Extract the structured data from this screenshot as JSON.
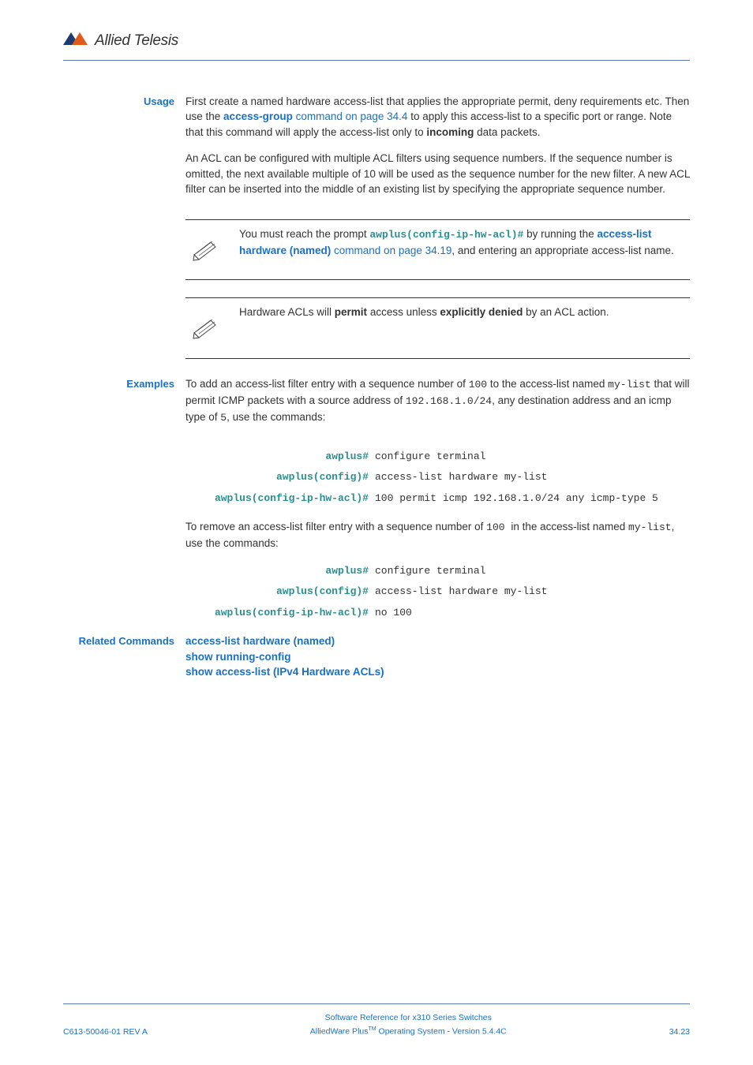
{
  "logo": {
    "brand": "Allied Telesis"
  },
  "usage": {
    "label": "Usage",
    "para1_a": "First create a named hardware access-list that applies the appropriate permit, deny requirements etc. Then use the ",
    "para1_link": "access-group",
    "para1_b": " command on page 34.4",
    "para1_c": " to apply this access-list to a specific port or range. Note that this command will apply the access-list only to ",
    "para1_bold": "incoming",
    "para1_d": " data packets.",
    "para2": "An ACL can be configured with multiple ACL filters using sequence numbers. If the sequence number is omitted, the next available multiple of 10 will be used as the sequence number for the new filter. A new ACL filter can be inserted into the middle of an existing list by specifying the appropriate sequence number."
  },
  "note1": {
    "pre": "You must reach the prompt ",
    "mono": "awplus(config-ip-hw-acl)#",
    "mid": " by running the ",
    "link": "access-list hardware (named)",
    "post_link": " command on page 34.19",
    "tail": ", and entering an appropriate access-list name."
  },
  "note2": {
    "a": "Hardware ACLs will ",
    "b": "permit",
    "c": " access unless ",
    "d": "explicitly denied",
    "e": " by an ACL action."
  },
  "examples": {
    "label": "Examples",
    "intro1_a": "To add an access-list filter entry with a sequence number of ",
    "intro1_m1": "100",
    "intro1_b": " to the access-list named ",
    "intro1_m2": "my-list",
    "intro1_c": " that will permit ICMP packets with a source address of ",
    "intro1_m3": "192.168.1.0/24",
    "intro1_d": ", any destination address and an icmp type of ",
    "intro1_m4": "5",
    "intro1_e": ", use the commands:",
    "cmds1": [
      {
        "prompt": "awplus#",
        "cmd": "configure terminal"
      },
      {
        "prompt": "awplus(config)#",
        "cmd": "access-list hardware my-list"
      },
      {
        "prompt": "awplus(config-ip-hw-acl)#",
        "cmd": "100 permit icmp 192.168.1.0/24 any icmp-type 5"
      }
    ],
    "intro2_a": "To remove an access-list filter entry with a sequence number of ",
    "intro2_m1": "100 ",
    "intro2_b": " in the access-list named ",
    "intro2_m2": "my-list",
    "intro2_c": ", use the commands:",
    "cmds2": [
      {
        "prompt": "awplus#",
        "cmd": "configure terminal"
      },
      {
        "prompt": "awplus(config)#",
        "cmd": "access-list hardware my-list"
      },
      {
        "prompt": "awplus(config-ip-hw-acl)#",
        "cmd": "no 100"
      }
    ]
  },
  "related": {
    "label": "Related Commands",
    "items": [
      "access-list hardware (named)",
      "show running-config",
      "show access-list (IPv4 Hardware ACLs)"
    ]
  },
  "footer": {
    "left": "C613-50046-01 REV A",
    "center1": "Software Reference for x310 Series Switches",
    "center2a": "AlliedWare Plus",
    "center2b": " Operating System - Version 5.4.4C",
    "right": "34.23"
  }
}
